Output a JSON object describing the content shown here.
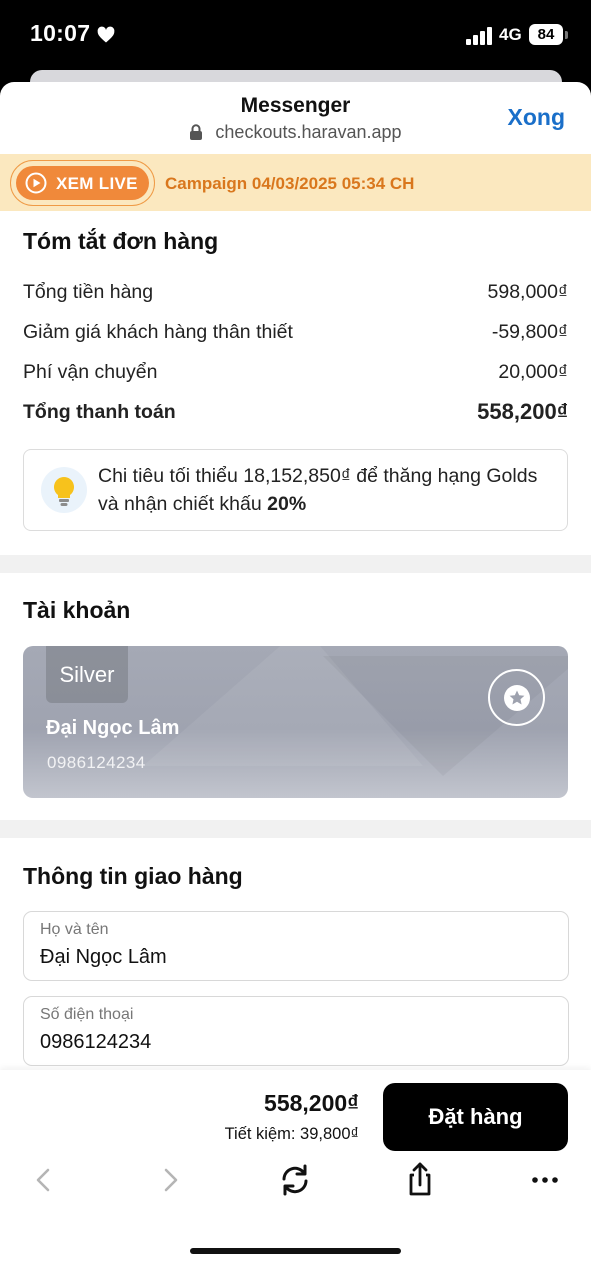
{
  "status_bar": {
    "time": "10:07",
    "network": "4G",
    "battery": "84"
  },
  "header": {
    "title": "Messenger",
    "url": "checkouts.haravan.app",
    "done_label": "Xong"
  },
  "live_banner": {
    "button_label": "XEM LIVE",
    "campaign": "Campaign 04/03/2025 05:34 CH",
    "accent": "#f0893a"
  },
  "summary": {
    "title": "Tóm tắt đơn hàng",
    "rows": [
      {
        "label": "Tổng tiền hàng",
        "value": "598,000₫"
      },
      {
        "label": "Giảm giá khách hàng thân thiết",
        "value": "-59,800₫"
      },
      {
        "label": "Phí vận chuyển",
        "value": "20,000₫"
      }
    ],
    "total_label": "Tổng thanh toán",
    "total_value": "558,200₫",
    "tip_prefix": "Chi tiêu tối thiểu 18,152,850₫ để thăng hạng Golds và nhận chiết khấu ",
    "tip_highlight": "20%"
  },
  "account": {
    "title": "Tài khoản",
    "tier": "Silver",
    "name": "Đại Ngọc Lâm",
    "phone": "0986124234",
    "icon": "star-icon"
  },
  "shipping": {
    "title": "Thông tin giao hàng",
    "fields": [
      {
        "label": "Họ và tên",
        "value": "Đại Ngọc Lâm"
      },
      {
        "label": "Số điện thoại",
        "value": "0986124234"
      }
    ]
  },
  "checkout": {
    "total": "558,200₫",
    "savings": "Tiết kiệm: 39,800₫",
    "order_label": "Đặt hàng"
  },
  "browser_nav": [
    "back-icon",
    "forward-icon",
    "reload-icon",
    "share-icon",
    "more-icon"
  ]
}
